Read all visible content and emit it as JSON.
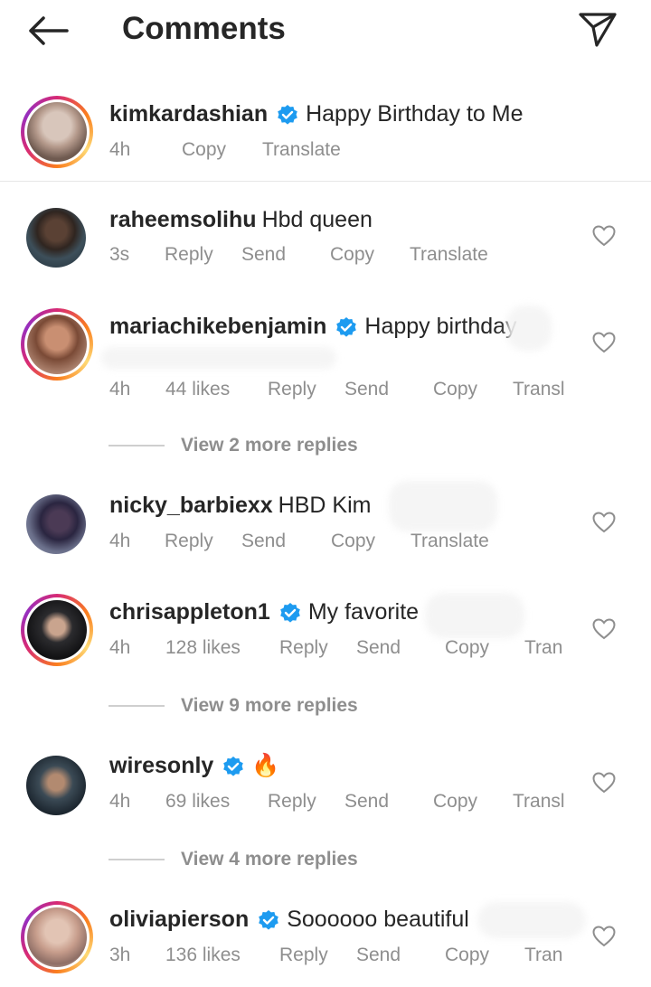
{
  "header": {
    "title": "Comments"
  },
  "caption": {
    "username": "kimkardashian",
    "verified": true,
    "text": "Happy Birthday to Me",
    "meta": {
      "time": "4h",
      "copy": "Copy",
      "translate": "Translate"
    }
  },
  "comments": [
    {
      "username": "raheemsolihu",
      "verified": false,
      "text": "Hbd queen",
      "meta": {
        "time": "3s",
        "reply": "Reply",
        "send": "Send",
        "copy": "Copy",
        "translate": "Translate"
      }
    },
    {
      "username": "mariachikebenjamin",
      "verified": true,
      "text": "Happy birthday",
      "meta": {
        "time": "4h",
        "likes": "44 likes",
        "reply": "Reply",
        "send": "Send",
        "copy": "Copy",
        "translate": "Transl"
      },
      "more_replies": "View 2 more replies"
    },
    {
      "username": "nicky_barbiexx",
      "verified": false,
      "text": "HBD Kim",
      "meta": {
        "time": "4h",
        "reply": "Reply",
        "send": "Send",
        "copy": "Copy",
        "translate": "Translate"
      }
    },
    {
      "username": "chrisappleton1",
      "verified": true,
      "text": "My favorite",
      "meta": {
        "time": "4h",
        "likes": "128 likes",
        "reply": "Reply",
        "send": "Send",
        "copy": "Copy",
        "translate": "Tran"
      },
      "more_replies": "View 9 more replies"
    },
    {
      "username": "wiresonly",
      "verified": true,
      "text": "🔥",
      "meta": {
        "time": "4h",
        "likes": "69 likes",
        "reply": "Reply",
        "send": "Send",
        "copy": "Copy",
        "translate": "Transl"
      },
      "more_replies": "View 4 more replies"
    },
    {
      "username": "oliviapierson",
      "verified": true,
      "text": "Soooooo beautiful",
      "meta": {
        "time": "3h",
        "likes": "136 likes",
        "reply": "Reply",
        "send": "Send",
        "copy": "Copy",
        "translate": "Tran"
      }
    }
  ],
  "colors": {
    "verified": "#1d9bf0",
    "meta": "#8e8e8e",
    "text": "#262626"
  },
  "icons": {
    "back": "arrow-left-icon",
    "share": "paper-plane-icon",
    "like": "heart-outline-icon",
    "verified": "verified-badge-icon"
  }
}
